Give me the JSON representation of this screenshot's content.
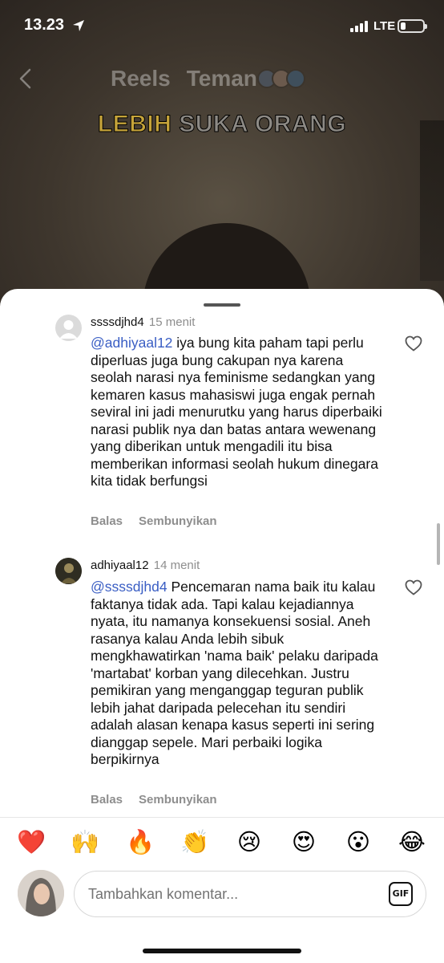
{
  "status_bar": {
    "time": "13.23",
    "network": "LTE"
  },
  "header": {
    "tabs": [
      {
        "label": "Reels"
      },
      {
        "label": "Teman"
      }
    ]
  },
  "video_overlay": {
    "word1": "LEBIH",
    "word2": "SUKA ORANG"
  },
  "comments": [
    {
      "username": "ssssdjhd4",
      "time": "15 menit",
      "mention": "@adhiyaal12",
      "text": " iya bung kita paham tapi perlu diperluas juga bung cakupan nya karena seolah narasi nya  feminisme sedangkan yang kemaren kasus mahasiswi juga engak pernah seviral ini jadi menurutku yang harus diperbaiki narasi publik nya dan batas antara wewenang yang diberikan untuk mengadili itu bisa memberikan informasi seolah hukum dinegara kita tidak berfungsi",
      "reply_label": "Balas",
      "hide_label": "Sembunyikan"
    },
    {
      "username": "adhiyaal12",
      "time": "14 menit",
      "mention": "@ssssdjhd4",
      "text": " Pencemaran nama baik itu kalau faktanya tidak ada. Tapi kalau kejadiannya nyata, itu namanya konsekuensi sosial. Aneh rasanya kalau Anda lebih sibuk mengkhawatirkan 'nama baik' pelaku daripada 'martabat' korban yang dilecehkan. Justru pemikiran yang menganggap teguran publik lebih jahat daripada pelecehan itu sendiri adalah alasan kenapa kasus seperti ini sering dianggap sepele. Mari perbaiki logika berpikirnya",
      "reply_label": "Balas",
      "hide_label": "Sembunyikan"
    }
  ],
  "emoji_bar": [
    "❤️",
    "🙌",
    "🔥",
    "👏",
    "😢",
    "😍",
    "😮",
    "😂"
  ],
  "composer": {
    "placeholder": "Tambahkan komentar...",
    "gif_label": "GIF"
  },
  "colors": {
    "mention": "#3a5ec4",
    "heart": "#e0242d"
  }
}
